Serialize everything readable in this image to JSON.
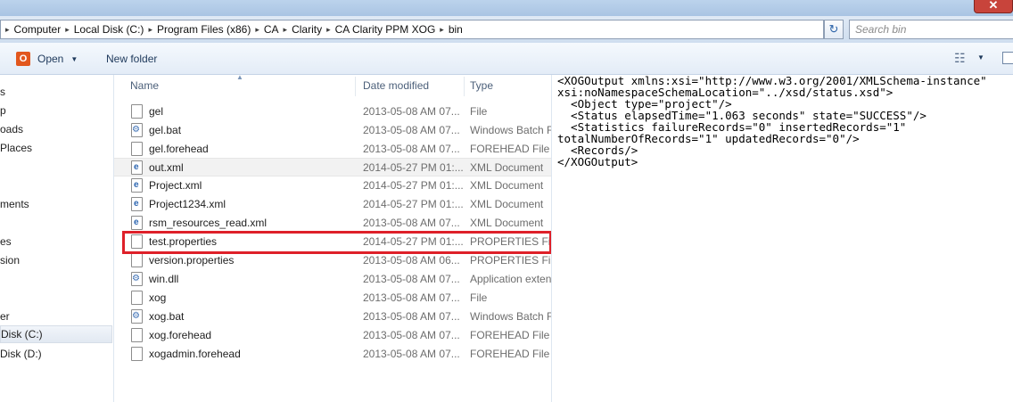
{
  "window": {
    "close_glyph": "✕"
  },
  "address": {
    "crumbs": [
      "Computer",
      "Local Disk (C:)",
      "Program Files (x86)",
      "CA",
      "Clarity",
      "CA Clarity PPM XOG",
      "bin"
    ],
    "separator": "▸",
    "refresh_glyph": "↻"
  },
  "search": {
    "placeholder": "Search bin"
  },
  "toolbar": {
    "open_label": "Open",
    "office_glyph": "O",
    "dropdown_glyph": "▼",
    "new_folder_label": "New folder",
    "view_glyph": "☷"
  },
  "nav": {
    "items": [
      {
        "label": "s"
      },
      {
        "label": "p"
      },
      {
        "label": "oads"
      },
      {
        "label": " Places"
      },
      {
        "label": "ments"
      },
      {
        "label": "es"
      },
      {
        "label": "sion"
      },
      {
        "label": "er"
      },
      {
        "label": "Disk (C:)"
      },
      {
        "label": "Disk (D:)"
      }
    ]
  },
  "columns": {
    "name": "Name",
    "date": "Date modified",
    "type": "Type",
    "sort_glyph": "▲"
  },
  "files": [
    {
      "name": "gel",
      "date": "2013-05-08 AM 07...",
      "type": "File",
      "icon": "blank-file-icon"
    },
    {
      "name": "gel.bat",
      "date": "2013-05-08 AM 07...",
      "type": "Windows Batch File",
      "icon": "batch-file-icon"
    },
    {
      "name": "gel.forehead",
      "date": "2013-05-08 AM 07...",
      "type": "FOREHEAD File",
      "icon": "blank-file-icon"
    },
    {
      "name": "out.xml",
      "date": "2014-05-27 PM 01:...",
      "type": "XML Document",
      "icon": "xml-file-icon"
    },
    {
      "name": "Project.xml",
      "date": "2014-05-27 PM 01:...",
      "type": "XML Document",
      "icon": "xml-file-icon"
    },
    {
      "name": "Project1234.xml",
      "date": "2014-05-27 PM 01:...",
      "type": "XML Document",
      "icon": "xml-file-icon"
    },
    {
      "name": "rsm_resources_read.xml",
      "date": "2013-05-08 AM 07...",
      "type": "XML Document",
      "icon": "xml-file-icon"
    },
    {
      "name": "test.properties",
      "date": "2014-05-27 PM 01:...",
      "type": "PROPERTIES File",
      "icon": "blank-file-icon"
    },
    {
      "name": "version.properties",
      "date": "2013-05-08 AM 06...",
      "type": "PROPERTIES File",
      "icon": "blank-file-icon"
    },
    {
      "name": "win.dll",
      "date": "2013-05-08 AM 07...",
      "type": "Application extension",
      "icon": "dll-file-icon"
    },
    {
      "name": "xog",
      "date": "2013-05-08 AM 07...",
      "type": "File",
      "icon": "blank-file-icon"
    },
    {
      "name": "xog.bat",
      "date": "2013-05-08 AM 07...",
      "type": "Windows Batch File",
      "icon": "batch-file-icon"
    },
    {
      "name": "xog.forehead",
      "date": "2013-05-08 AM 07...",
      "type": "FOREHEAD File",
      "icon": "blank-file-icon"
    },
    {
      "name": "xogadmin.forehead",
      "date": "2013-05-08 AM 07...",
      "type": "FOREHEAD File",
      "icon": "blank-file-icon"
    }
  ],
  "preview": {
    "lines": [
      "<XOGOutput xmlns:xsi=\"http://www.w3.org/2001/XMLSchema-instance\"",
      "xsi:noNamespaceSchemaLocation=\"../xsd/status.xsd\">",
      "  <Object type=\"project\"/>",
      "  <Status elapsedTime=\"1.063 seconds\" state=\"SUCCESS\"/>",
      "  <Statistics failureRecords=\"0\" insertedRecords=\"1\"",
      "totalNumberOfRecords=\"1\" updatedRecords=\"0\"/>",
      "  <Records/>",
      "</XOGOutput>"
    ]
  },
  "colors": {
    "highlight": "#de2029",
    "hover_row": "#f2f2f2"
  }
}
